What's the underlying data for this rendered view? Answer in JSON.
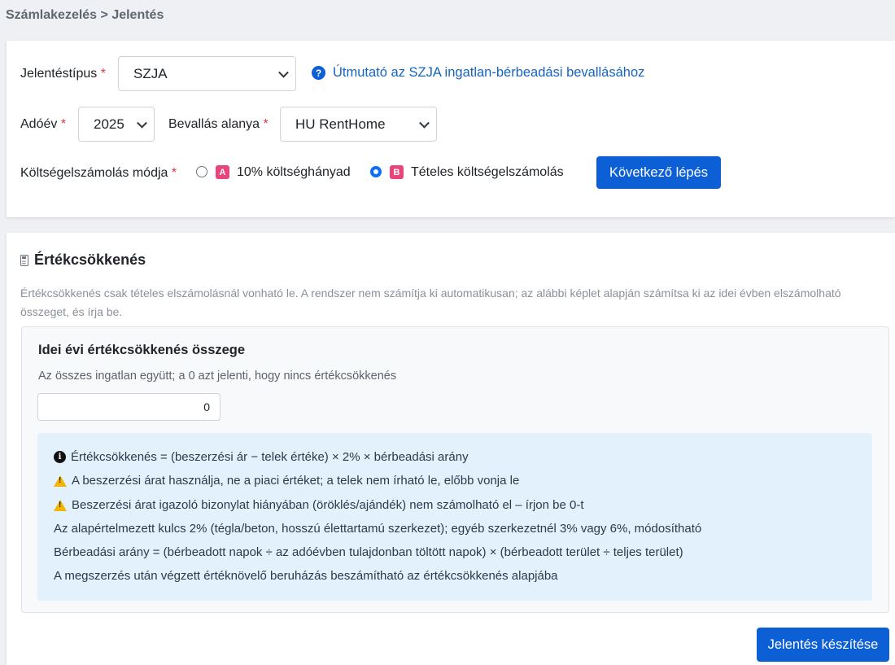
{
  "breadcrumb": "Számlakezelés > Jelentés",
  "form": {
    "report_type_label": "Jelentéstípus",
    "report_type_value": "SZJA",
    "help_link": "Útmutató az SZJA ingatlan-bérbeadási bevallásához",
    "tax_year_label": "Adóév",
    "tax_year_value": "2025",
    "subject_label": "Bevallás alanya",
    "subject_value": "HU RentHome",
    "cost_method_label": "Költségelszámolás módja",
    "option_a_badge": "A",
    "option_a_label": "10% költséghányad",
    "option_a_checked": false,
    "option_b_badge": "B",
    "option_b_label": "Tételes költségelszámolás",
    "option_b_checked": true,
    "next_button": "Következő lépés",
    "required_mark": "*"
  },
  "depreciation": {
    "title": "Értékcsökkenés",
    "description": "Értékcsökkenés csak tételes elszámolásnál vonható le. A rendszer nem számítja ki automatikusan; az alábbi képlet alapján számítsa ki az idei évben elszámolható összeget, és írja be.",
    "field_title": "Idei évi értékcsökkenés összege",
    "field_help": "Az összes ingatlan együtt; a 0 azt jelenti, hogy nincs értékcsökkenés",
    "field_value": "0",
    "info_lines": [
      "Értékcsökkenés = (beszerzési ár − telek értéke) × 2% × bérbeadási arány",
      "A beszerzési árat használja, ne a piaci értéket; a telek nem írható le, előbb vonja le",
      "Beszerzési árat igazoló bizonylat hiányában (öröklés/ajándék) nem számolható el – írjon be 0-t",
      "Az alapértelmezett kulcs 2% (tégla/beton, hosszú élettartamú szerkezet); egyéb szerkezetnél 3% vagy 6%, módosítható",
      "Bérbeadási arány = (bérbeadott napok ÷ az adóévben tulajdonban töltött napok) × (bérbeadott terület ÷ teljes terület)",
      "A megszerzés után végzett értéknövelő beruházás beszámítható az értékcsökkenés alapjába"
    ],
    "submit_button": "Jelentés készítése"
  },
  "colors": {
    "primary": "#0d5fd6",
    "required": "#dc3545",
    "badge": "#e8457a",
    "info_bg": "#e3f1fd",
    "warning": "#f4b400"
  }
}
